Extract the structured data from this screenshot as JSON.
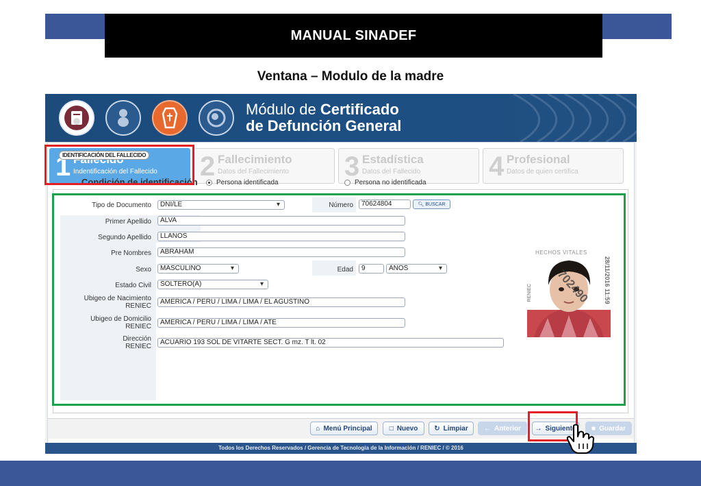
{
  "slide": {
    "title": "MANUAL SINADEF",
    "subtitle": "Ventana – Modulo de la madre",
    "colors": {
      "band": "#3b5797",
      "title_bg": "#000000",
      "highlight_red": "#e41e25",
      "highlight_green": "#19a14b"
    }
  },
  "app": {
    "title_line1_light": "Módulo de ",
    "title_line1_bold": "Certificado",
    "title_line2": "de Defunción General",
    "header_icons": [
      "certificate-icon",
      "baby-icon",
      "coffin-icon",
      "fetal-icon"
    ],
    "steps": [
      {
        "num": "1",
        "title": "Fallecido",
        "desc": "Indentificación del Fallecido",
        "active": true
      },
      {
        "num": "2",
        "title": "Fallecimiento",
        "desc": "Datos del Fallecimiento",
        "active": false
      },
      {
        "num": "3",
        "title": "Estadística",
        "desc": "Datos del Fallecido",
        "active": false
      },
      {
        "num": "4",
        "title": "Profesional",
        "desc": "Datos de quien certifica",
        "active": false
      }
    ],
    "section_legend": "IDENTIFICACIÓN DEL FALLECIDO",
    "condition": {
      "label": "Condición de identificación",
      "option_identified": "Persona identificada",
      "option_not_identified": "Persona no identificada",
      "selected": "Persona identificada"
    },
    "form": {
      "tipo_documento_label": "Tipo de Documento",
      "tipo_documento_value": "DNI/LE",
      "numero_label": "Número",
      "numero_value": "70624804",
      "buscar_label": "BUSCAR",
      "primer_apellido_label": "Primer Apellido",
      "primer_apellido_value": "ALVA",
      "segundo_apellido_label": "Segundo Apellido",
      "segundo_apellido_value": "LLANOS",
      "pre_nombres_label": "Pre Nombres",
      "pre_nombres_value": "ABRAHAM",
      "sexo_label": "Sexo",
      "sexo_value": "MASCULINO",
      "edad_label": "Edad",
      "edad_value": "9",
      "edad_unit": "AÑOS",
      "estado_civil_label": "Estado Civil",
      "estado_civil_value": "SOLTERO(A)",
      "ubigeo_nac_label_1": "Ubigeo de Nacimiento",
      "ubigeo_nac_label_2": "RENIEC",
      "ubigeo_nac_value": "AMERICA / PERU / LIMA / LIMA / EL AGUSTINO",
      "ubigeo_dom_label_1": "Ubigeo de Domicilio",
      "ubigeo_dom_label_2": "RENIEC",
      "ubigeo_dom_value": "AMERICA / PERU / LIMA / LIMA / ATE",
      "direccion_label_1": "Dirección",
      "direccion_label_2": "RENIEC",
      "direccion_value": "ACUARIO 193 SOL DE VITARTE SECT. G mz. T lt. 02"
    },
    "photo": {
      "stamp_top": "HECHOS VITALES",
      "stamp_side": "28/11/2016 11:59",
      "stamp_left": "RENIEC",
      "stamp_diag": "702490"
    },
    "buttons": {
      "menu": "Menú Principal",
      "nuevo": "Nuevo",
      "limpiar": "Limpiar",
      "anterior": "Anterior",
      "siguiente": "Siguiente",
      "guardar": "Guardar"
    },
    "footer": "Todos los Derechos Reservados / Gerencia de Tecnología de la Información / RENIEC / © 2016"
  }
}
